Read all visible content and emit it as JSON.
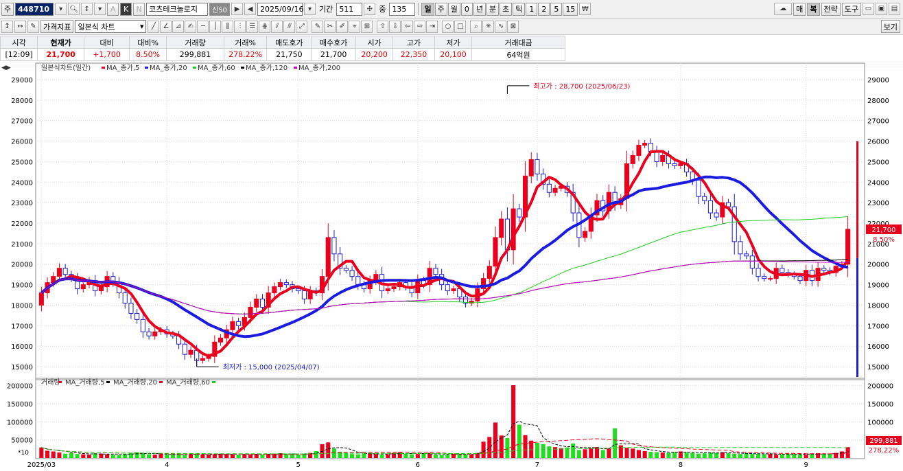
{
  "toolbar": {
    "market_label": "주",
    "code": "448710",
    "name": "코츠테크놀로지",
    "badge": "신50",
    "date": "2025/09/16",
    "period_label": "기간",
    "period_value": "511",
    "count_label": "중",
    "count_value": "135",
    "period_tabs": [
      "일",
      "주",
      "월",
      "0",
      "년",
      "분",
      "초",
      "틱",
      "1",
      "2",
      "5",
      "15"
    ],
    "right_buttons": [
      "매",
      "복",
      "전략",
      "도구"
    ],
    "indicator_select": "가격지표",
    "chart_type_select": "일본식 차트",
    "view_button": "보기"
  },
  "quote": {
    "headers": [
      "시각",
      "현재가",
      "대비",
      "대비%",
      "거래량",
      "거래%",
      "매도호가",
      "매수호가",
      "시가",
      "고가",
      "저가",
      "거래대금"
    ],
    "values": [
      "[12:09]",
      "21,700",
      "+1,700",
      "8.50%",
      "299,881",
      "278.22%",
      "21,750",
      "21,700",
      "20,200",
      "22,350",
      "20,100",
      "64억원"
    ]
  },
  "colors": {
    "up": "#e8001c",
    "down": "#1b1bd6",
    "ma5": "#e8001c",
    "ma20": "#1a1ae0",
    "ma60": "#22cc22",
    "ma120": "#000000",
    "ma200": "#cc00cc",
    "vol_up": "#e8001c",
    "vol_down": "#22dd22"
  },
  "chart_data": [
    {
      "type": "candlestick",
      "title": "일본식차트(일간)",
      "legend": [
        "MA_종가,5",
        "MA_종가,20",
        "MA_종가,60",
        "MA_종가,120",
        "MA_종가,200"
      ],
      "legend_placement": "top-left",
      "ylim": [
        14500,
        29300
      ],
      "yticks": [
        15000,
        16000,
        17000,
        18000,
        19000,
        20000,
        21000,
        22000,
        23000,
        24000,
        25000,
        26000,
        27000,
        28000,
        29000
      ],
      "x_labels": [
        {
          "i": 0,
          "label": "2025/03"
        },
        {
          "i": 21,
          "label": "4"
        },
        {
          "i": 43,
          "label": "5"
        },
        {
          "i": 63,
          "label": "6"
        },
        {
          "i": 83,
          "label": "7"
        },
        {
          "i": 107,
          "label": "8"
        },
        {
          "i": 128,
          "label": "9"
        }
      ],
      "annotations": [
        {
          "text": "최고가 : 28,700 (2025/06/23)",
          "i": 78,
          "value": 28700,
          "color": "#e8001c"
        },
        {
          "text": "최저가 : 15,000 (2025/04/07)",
          "i": 26,
          "value": 15000,
          "color": "#1b1bd6"
        }
      ],
      "last_price": {
        "value": 21700,
        "label": "21,700",
        "change": "8.50%"
      },
      "close": [
        18600,
        19100,
        19400,
        19800,
        19500,
        19300,
        18800,
        19000,
        19200,
        18700,
        18900,
        19400,
        19100,
        18600,
        18100,
        17600,
        17300,
        16700,
        16500,
        16700,
        16800,
        16600,
        16500,
        16100,
        15600,
        15800,
        15300,
        15400,
        15500,
        16200,
        16400,
        16800,
        17200,
        17000,
        17400,
        17900,
        18300,
        17900,
        18600,
        18900,
        19100,
        19000,
        18800,
        18700,
        18300,
        18700,
        18600,
        19400,
        21300,
        20500,
        19800,
        19700,
        19400,
        19000,
        18800,
        19200,
        19500,
        18700,
        18800,
        18900,
        19100,
        18900,
        18600,
        19200,
        19000,
        19800,
        19500,
        19000,
        18700,
        18800,
        18400,
        18100,
        18200,
        18800,
        19300,
        19900,
        21300,
        22200,
        20700,
        22700,
        22300,
        24300,
        25100,
        24400,
        23900,
        23500,
        23700,
        23800,
        23500,
        22500,
        21300,
        21600,
        22400,
        23100,
        22600,
        23500,
        22900,
        23200,
        24900,
        25300,
        25800,
        25900,
        25500,
        25000,
        25300,
        24900,
        24800,
        24900,
        24500,
        24100,
        23300,
        23100,
        22500,
        22300,
        23000,
        22800,
        21100,
        20500,
        20400,
        19800,
        19400,
        19300,
        19300,
        19800,
        19600,
        19500,
        19400,
        19200,
        19700,
        19200,
        19800,
        19700,
        19600,
        19900,
        20000,
        21700
      ],
      "volume_ylim": [
        0,
        205000
      ],
      "volume_yticks": [
        50000,
        100000,
        150000,
        200000
      ],
      "volume_last": {
        "value": 299881,
        "label": "299,881",
        "pct": "278.22%"
      },
      "volume_legend": [
        "거래량",
        "MA_거래량,5",
        "MA_거래량,20",
        "MA_거래량,60"
      ],
      "volume_scale_note": "*10",
      "volume": [
        29000,
        20000,
        18000,
        15000,
        12000,
        14000,
        11000,
        10000,
        9000,
        13000,
        12000,
        10000,
        9000,
        8000,
        11000,
        14000,
        16000,
        12000,
        10000,
        9000,
        11000,
        9000,
        10000,
        12000,
        8000,
        9000,
        11000,
        9000,
        8000,
        10000,
        12000,
        11000,
        9000,
        8000,
        9000,
        10000,
        11000,
        9000,
        10000,
        12000,
        13000,
        11000,
        10000,
        9000,
        12000,
        14000,
        19000,
        38000,
        43000,
        26000,
        17000,
        14000,
        11000,
        10000,
        12000,
        13000,
        11000,
        9000,
        10000,
        14000,
        16000,
        12000,
        10000,
        11000,
        12000,
        14000,
        9000,
        8000,
        10000,
        12000,
        11000,
        10000,
        9000,
        14000,
        45000,
        58000,
        98000,
        62000,
        55000,
        201000,
        92000,
        63000,
        48000,
        42000,
        38000,
        32000,
        30000,
        27000,
        29000,
        40000,
        22000,
        24000,
        27000,
        30000,
        22000,
        26000,
        82000,
        35000,
        28000,
        26000,
        22000,
        19000,
        17000,
        16000,
        15000,
        14000,
        16000,
        18000,
        15000,
        14000,
        12000,
        13000,
        15000,
        14000,
        16000,
        13000,
        12000,
        11000,
        13000,
        11000,
        12000,
        10000,
        11000,
        9000,
        10000,
        12000,
        11000,
        10000,
        9000,
        11000,
        13000,
        12000,
        11000,
        14000,
        18000,
        30000
      ]
    }
  ]
}
